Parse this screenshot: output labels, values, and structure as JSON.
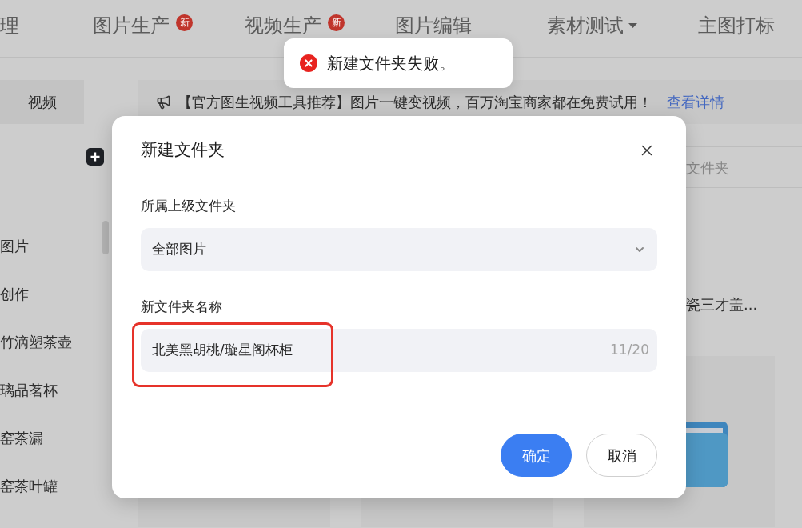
{
  "top_nav": [
    {
      "label": "理",
      "has_menu": false
    },
    {
      "label": "图片生产",
      "badge": "新",
      "has_menu": false
    },
    {
      "label": "视频生产",
      "badge": "新",
      "has_menu": false
    },
    {
      "label": "图片编辑",
      "has_menu": false
    },
    {
      "label": "素材测试",
      "has_menu": true
    },
    {
      "label": "主图打标",
      "has_menu": false
    }
  ],
  "sidebar": {
    "tab": "视频",
    "items": [
      "图片",
      "创作",
      "竹滴塑茶壶",
      "璃品茗杯",
      "窑茶漏",
      "窑茶叶罐"
    ]
  },
  "notice": {
    "text": "【官方图生视频工具推荐】图片一键变视频，百万淘宝商家都在免费试用！",
    "link": "查看详情"
  },
  "folder_list": {
    "column_header": "文件夹",
    "item_name": "瓷三才盖..."
  },
  "toast": {
    "kind": "error",
    "message": "新建文件夹失败。"
  },
  "dialog": {
    "title": "新建文件夹",
    "fields": [
      {
        "kind": "select",
        "label": "所属上级文件夹",
        "value": "全部图片",
        "highlighted": false
      },
      {
        "kind": "text",
        "label": "新文件夹名称",
        "value": "北美黑胡桃/璇星阁杯柜",
        "counter": "11/20",
        "highlighted": true
      }
    ],
    "buttons": [
      {
        "kind": "confirm",
        "label": "确定"
      },
      {
        "kind": "cancel",
        "label": "取消"
      }
    ]
  }
}
